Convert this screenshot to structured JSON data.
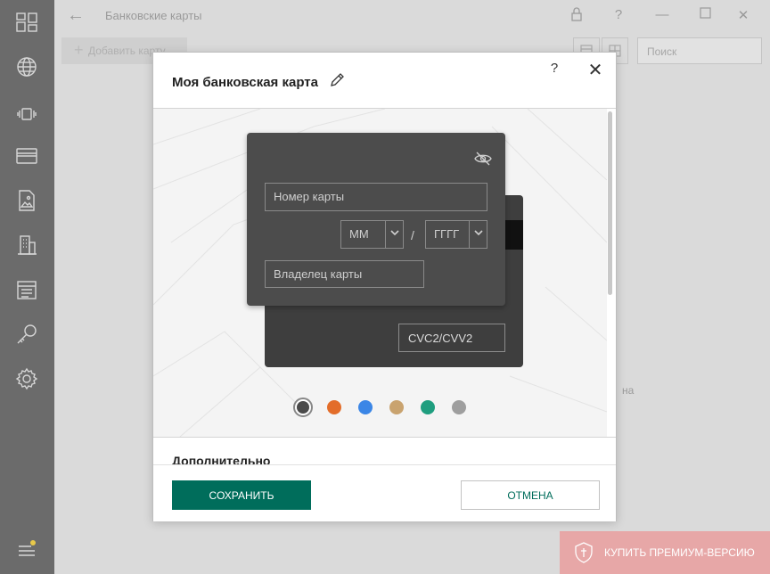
{
  "window": {
    "title": "Банковские карты",
    "back_icon": "back-arrow-icon",
    "controls": [
      "lock-icon",
      "help-icon",
      "minimize-icon",
      "maximize-icon",
      "close-icon"
    ]
  },
  "sidebar": {
    "items": [
      "dashboard-icon",
      "globe-icon",
      "device-icon",
      "card-icon",
      "image-icon",
      "building-icon",
      "calendar-icon",
      "key-icon",
      "settings-icon",
      "menu-icon"
    ]
  },
  "toolbar": {
    "add_label": "Добавить карту",
    "search_placeholder": "Поиск"
  },
  "background": {
    "partial_text": "на",
    "premium_label": "КУПИТЬ ПРЕМИУМ-ВЕРСИЮ"
  },
  "dialog": {
    "title": "Моя банковская карта",
    "help_label": "?",
    "close_label": "✕",
    "card": {
      "number_placeholder": "Номер карты",
      "month_value": "ММ",
      "separator": "/",
      "year_value": "ГГГГ",
      "owner_placeholder": "Владелец карты",
      "cvc_placeholder": "CVC2/CVV2"
    },
    "colors": [
      "#4a4a4a",
      "#e36d2a",
      "#3b86e6",
      "#c9a36f",
      "#1f9e7f",
      "#9e9e9e"
    ],
    "selected_color": "#4a4a4a",
    "section_title": "Дополнительно",
    "save_label": "СОХРАНИТЬ",
    "cancel_label": "ОТМЕНА"
  }
}
